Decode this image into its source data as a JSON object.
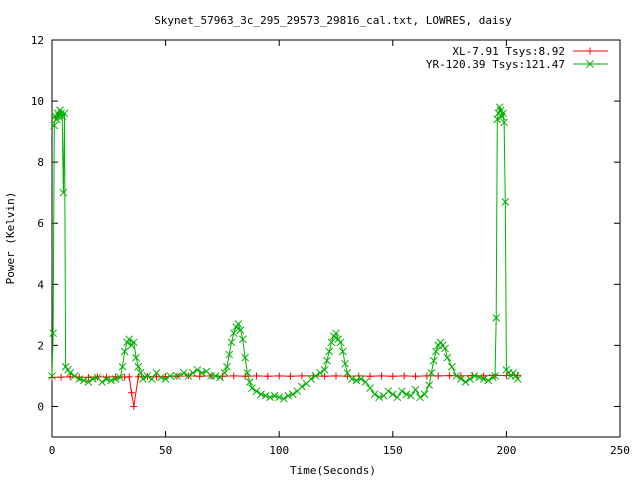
{
  "chart_data": {
    "type": "line",
    "title": "Skynet_57963_3c_295_29573_29816_cal.txt, LOWRES, daisy",
    "xlabel": "Time(Seconds)",
    "ylabel": "Power (Kelvin)",
    "xlim": [
      0,
      250
    ],
    "ylim": [
      -1,
      12
    ],
    "xticks": [
      0,
      50,
      100,
      150,
      200,
      250
    ],
    "yticks": [
      0,
      2,
      4,
      6,
      8,
      10,
      12
    ],
    "grid": false,
    "legend_position": "top-right",
    "series": [
      {
        "name": "XL-7.91 Tsys:8.92",
        "color": "#ff0000",
        "marker": "plus",
        "x": [
          0,
          4,
          8,
          12,
          16,
          20,
          24,
          28,
          32,
          34,
          35,
          36,
          38,
          42,
          46,
          50,
          55,
          60,
          65,
          70,
          75,
          80,
          85,
          90,
          95,
          100,
          105,
          110,
          115,
          120,
          125,
          130,
          135,
          140,
          145,
          150,
          155,
          160,
          165,
          170,
          175,
          180,
          185,
          190,
          195,
          200,
          205
        ],
        "y": [
          0.95,
          0.96,
          0.97,
          0.96,
          0.95,
          0.97,
          0.96,
          0.97,
          0.96,
          0.97,
          0.45,
          0.0,
          0.97,
          0.98,
          0.97,
          0.98,
          0.99,
          1.0,
          0.99,
          1.0,
          0.99,
          1.0,
          0.99,
          1.0,
          0.99,
          1.0,
          0.99,
          1.0,
          1.0,
          0.99,
          1.0,
          0.99,
          1.0,
          0.99,
          1.0,
          0.99,
          1.0,
          0.99,
          1.0,
          1.0,
          1.01,
          1.0,
          1.01,
          1.0,
          1.02,
          1.01,
          1.02
        ]
      },
      {
        "name": "YR-120.39 Tsys:121.47",
        "color": "#00b000",
        "marker": "cross",
        "x": [
          0,
          0.5,
          1,
          1.5,
          2,
          2.5,
          3,
          3.5,
          4,
          4.5,
          5,
          5.5,
          6,
          7,
          8,
          10,
          12,
          14,
          16,
          18,
          20,
          22,
          24,
          26,
          28,
          30,
          31,
          32,
          33,
          34,
          35,
          36,
          37,
          38,
          39,
          40,
          42,
          44,
          46,
          48,
          50,
          52,
          55,
          58,
          60,
          62,
          64,
          66,
          68,
          70,
          72,
          74,
          76,
          77,
          78,
          79,
          80,
          81,
          82,
          83,
          84,
          85,
          86,
          87,
          88,
          90,
          92,
          94,
          96,
          98,
          100,
          102,
          104,
          106,
          108,
          110,
          112,
          114,
          116,
          118,
          120,
          121,
          122,
          123,
          124,
          125,
          126,
          127,
          128,
          129,
          130,
          132,
          134,
          136,
          138,
          140,
          142,
          144,
          146,
          148,
          150,
          152,
          154,
          156,
          158,
          160,
          162,
          164,
          166,
          167,
          168,
          169,
          170,
          171,
          172,
          173,
          174,
          176,
          178,
          180,
          182,
          184,
          186,
          188,
          190,
          192,
          194,
          195,
          195.5,
          196,
          196.5,
          197,
          197.5,
          198,
          198.5,
          199,
          199.5,
          200,
          201,
          202,
          203,
          204,
          205
        ],
        "y": [
          1.0,
          2.4,
          9.2,
          9.5,
          9.4,
          9.6,
          9.5,
          9.7,
          9.6,
          9.5,
          7.0,
          9.6,
          1.3,
          1.2,
          1.1,
          1.0,
          0.9,
          0.85,
          0.8,
          0.9,
          0.95,
          0.8,
          0.9,
          0.85,
          0.9,
          0.95,
          1.3,
          1.8,
          2.1,
          2.2,
          2.0,
          2.1,
          1.6,
          1.3,
          1.1,
          0.9,
          1.0,
          0.9,
          1.1,
          0.95,
          0.9,
          1.0,
          1.0,
          1.1,
          1.0,
          1.1,
          1.2,
          1.1,
          1.15,
          1.0,
          1.0,
          0.95,
          1.1,
          1.3,
          1.7,
          2.1,
          2.4,
          2.6,
          2.7,
          2.5,
          2.2,
          1.6,
          1.1,
          0.8,
          0.6,
          0.5,
          0.4,
          0.35,
          0.3,
          0.35,
          0.3,
          0.25,
          0.35,
          0.4,
          0.5,
          0.65,
          0.75,
          0.9,
          1.0,
          1.1,
          1.2,
          1.5,
          1.8,
          2.1,
          2.3,
          2.4,
          2.2,
          2.1,
          1.8,
          1.4,
          1.1,
          0.9,
          0.85,
          0.9,
          0.8,
          0.6,
          0.4,
          0.3,
          0.35,
          0.5,
          0.4,
          0.3,
          0.5,
          0.4,
          0.35,
          0.55,
          0.3,
          0.4,
          0.7,
          1.1,
          1.5,
          1.8,
          2.0,
          2.1,
          2.0,
          1.9,
          1.6,
          1.3,
          1.0,
          0.9,
          0.8,
          0.9,
          1.0,
          0.95,
          0.9,
          0.85,
          0.95,
          1.0,
          2.9,
          9.4,
          9.6,
          9.8,
          9.7,
          9.5,
          9.6,
          9.3,
          6.7,
          1.2,
          1.1,
          1.0,
          1.1,
          1.0,
          0.9
        ]
      }
    ]
  }
}
